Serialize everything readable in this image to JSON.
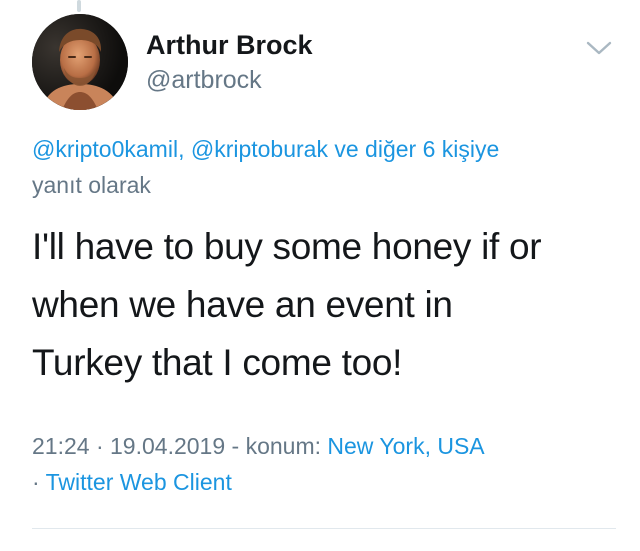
{
  "tweet": {
    "author": {
      "display_name": "Arthur Brock",
      "handle": "@artbrock"
    },
    "reply_context": {
      "mention_1": "@kripto0kamil",
      "separator": ", ",
      "mention_2": "@kriptoburak",
      "others": " ve diğer 6 kişiye",
      "suffix": "yanıt olarak"
    },
    "text_lines": [
      "I'll have to buy some honey if or",
      "when we have an event in",
      "Turkey that I come too!"
    ],
    "meta": {
      "time": "21:24",
      "dot": " · ",
      "date": "19.04.2019",
      "location_prefix": " - konum: ",
      "location": "New York, USA",
      "source_prefix": "· ",
      "source": "Twitter Web Client"
    }
  },
  "icons": {
    "more_menu": "chevron-down-icon",
    "avatar": "avatar"
  },
  "colors": {
    "link": "#1b95e0",
    "secondary_text": "#657786",
    "primary_text": "#14171a",
    "divider": "#e1e8ed"
  }
}
